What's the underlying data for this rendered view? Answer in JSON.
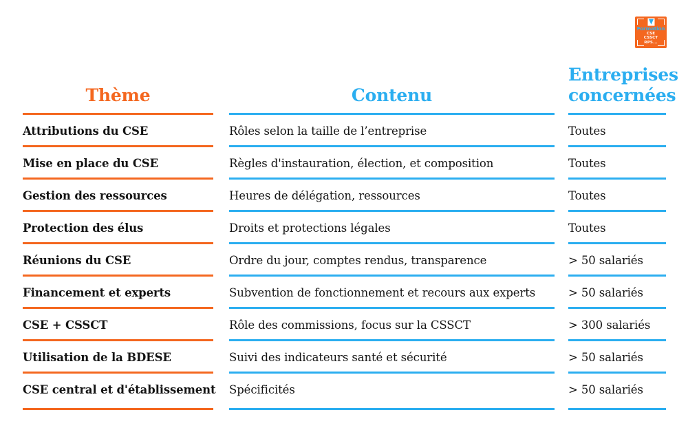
{
  "brand": {
    "logo": {
      "name": "formation-cse-logo",
      "wordmark": "Formation",
      "lines": [
        "CSE",
        "CSSCT",
        "RPS..."
      ],
      "bg_color": "#F4671F",
      "accent_color": "#33AEEF"
    }
  },
  "colors": {
    "orange": "#F4671F",
    "blue": "#2BAEF0",
    "text": "#141414",
    "background": "#FFFFFF"
  },
  "table": {
    "columns": [
      {
        "key": "theme",
        "label": "Thème",
        "accent": "#F4671F"
      },
      {
        "key": "contenu",
        "label": "Contenu",
        "accent": "#2BAEF0"
      },
      {
        "key": "entreprise",
        "label": "Entreprises concernées",
        "accent": "#2BAEF0"
      }
    ],
    "rows": [
      {
        "theme": "Attributions du CSE",
        "contenu": "Rôles selon la taille de l’entreprise",
        "entreprise": "Toutes"
      },
      {
        "theme": "Mise en place du CSE",
        "contenu": "Règles d'instauration, élection, et composition",
        "entreprise": "Toutes"
      },
      {
        "theme": "Gestion des ressources",
        "contenu": "Heures de délégation, ressources",
        "entreprise": "Toutes"
      },
      {
        "theme": "Protection des élus",
        "contenu": "Droits et protections légales",
        "entreprise": "Toutes"
      },
      {
        "theme": "Réunions du CSE",
        "contenu": "Ordre du jour, comptes rendus, transparence",
        "entreprise": "> 50 salariés"
      },
      {
        "theme": "Financement et experts",
        "contenu": "Subvention de fonctionnement et recours aux experts",
        "entreprise": "> 50 salariés"
      },
      {
        "theme": "CSE + CSSCT",
        "contenu": "Rôle des commissions, focus sur la CSSCT",
        "entreprise": "> 300 salariés"
      },
      {
        "theme": "Utilisation de la BDESE",
        "contenu": "Suivi des indicateurs santé et sécurité",
        "entreprise": "> 50 salariés"
      },
      {
        "theme": "CSE central et d'établissement",
        "contenu": "Spécificités",
        "entreprise": "> 50 salariés"
      }
    ]
  }
}
